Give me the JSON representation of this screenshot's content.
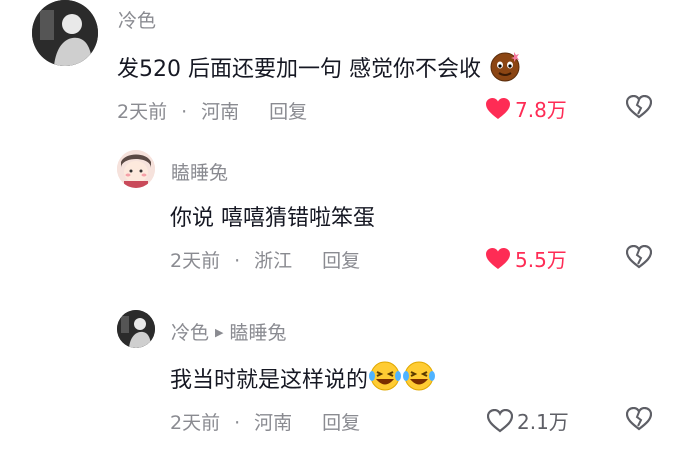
{
  "comments": [
    {
      "user": "冷色",
      "text": "发520 后面还要加一句 感觉你不会收",
      "time": "2天前",
      "location": "河南",
      "reply_label": "回复",
      "likes": "7.8万",
      "liked": true,
      "emoji": "chocolate-emoji"
    },
    {
      "user": "瞌睡兔",
      "text": "你说 嘻嘻猜错啦笨蛋",
      "time": "2天前",
      "location": "浙江",
      "reply_label": "回复",
      "likes": "5.5万",
      "liked": true
    },
    {
      "user": "冷色",
      "reply_to": "瞌睡兔",
      "text": "我当时就是这样说的",
      "time": "2天前",
      "location": "河南",
      "reply_label": "回复",
      "likes": "2.1万",
      "liked": false,
      "emoji": "laughing-tears-emoji"
    }
  ],
  "colors": {
    "like_active": "#fe2c55",
    "meta_gray": "#8a8b91",
    "text_dark": "#161823"
  }
}
